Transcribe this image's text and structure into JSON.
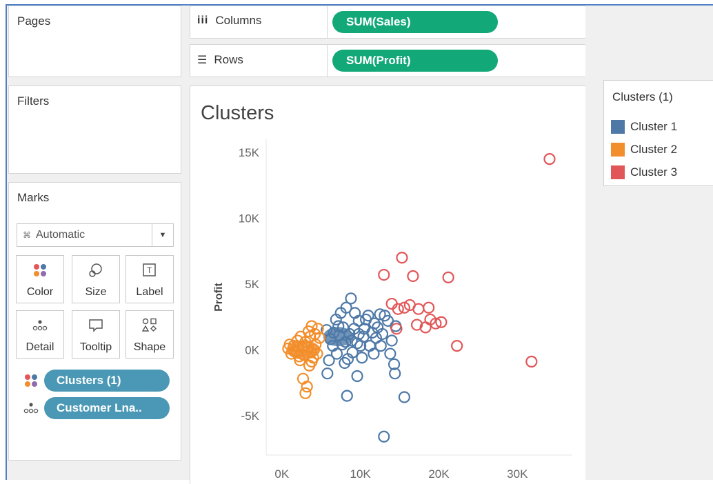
{
  "shelves": {
    "pages_label": "Pages",
    "filters_label": "Filters",
    "columns_label": "Columns",
    "columns_pill": "SUM(Sales)",
    "rows_label": "Rows",
    "rows_pill": "SUM(Profit)"
  },
  "marks": {
    "title": "Marks",
    "mark_type": "Automatic",
    "buttons": [
      "Color",
      "Size",
      "Label",
      "Detail",
      "Tooltip",
      "Shape"
    ],
    "fields": [
      "Clusters (1)",
      "Customer Lna.."
    ]
  },
  "legend": {
    "title": "Clusters (1)",
    "items": [
      {
        "label": "Cluster 1",
        "color": "#4e79a7"
      },
      {
        "label": "Cluster 2",
        "color": "#f28e2b"
      },
      {
        "label": "Cluster 3",
        "color": "#e15759"
      }
    ]
  },
  "chart_title": "Clusters",
  "chart_data": {
    "type": "scatter",
    "title": "Clusters",
    "xlabel": "",
    "ylabel": "Profit",
    "xlim": [
      -2000,
      37000
    ],
    "ylim": [
      -8000,
      16000
    ],
    "xticks": [
      {
        "v": 0,
        "label": "0K"
      },
      {
        "v": 10000,
        "label": "10K"
      },
      {
        "v": 20000,
        "label": "20K"
      },
      {
        "v": 30000,
        "label": "30K"
      }
    ],
    "yticks": [
      {
        "v": 15000,
        "label": "15K"
      },
      {
        "v": 10000,
        "label": "10K"
      },
      {
        "v": 5000,
        "label": "5K"
      },
      {
        "v": 0,
        "label": "0K"
      },
      {
        "v": -5000,
        "label": "-5K"
      }
    ],
    "grid": false,
    "marker": "open-circle",
    "series": [
      {
        "name": "Cluster 1",
        "color": "#4e79a7",
        "points": [
          [
            8800,
            3900
          ],
          [
            8200,
            3200
          ],
          [
            7500,
            2800
          ],
          [
            9800,
            2200
          ],
          [
            11000,
            2600
          ],
          [
            12500,
            2700
          ],
          [
            11800,
            2000
          ],
          [
            10500,
            1600
          ],
          [
            13500,
            2200
          ],
          [
            12800,
            1200
          ],
          [
            14500,
            1800
          ],
          [
            14000,
            700
          ],
          [
            13800,
            -300
          ],
          [
            12000,
            900
          ],
          [
            11200,
            300
          ],
          [
            10200,
            -600
          ],
          [
            9000,
            -200
          ],
          [
            8100,
            600
          ],
          [
            7300,
            1100
          ],
          [
            6500,
            300
          ],
          [
            7000,
            -300
          ],
          [
            6000,
            -800
          ],
          [
            5800,
            -1800
          ],
          [
            8000,
            -1000
          ],
          [
            9600,
            -2000
          ],
          [
            14300,
            -1100
          ],
          [
            14400,
            -1800
          ],
          [
            15600,
            -3600
          ],
          [
            8300,
            -3500
          ],
          [
            13000,
            -6600
          ],
          [
            6900,
            2300
          ],
          [
            7800,
            1700
          ],
          [
            8600,
            1200
          ],
          [
            9300,
            2800
          ],
          [
            10700,
            2300
          ],
          [
            12200,
            1700
          ],
          [
            13100,
            2600
          ],
          [
            11500,
            1300
          ],
          [
            9800,
            1200
          ],
          [
            8900,
            700
          ],
          [
            9600,
            500
          ],
          [
            10400,
            1000
          ],
          [
            6200,
            800
          ],
          [
            5700,
            1500
          ],
          [
            7200,
            1800
          ],
          [
            6600,
            1300
          ],
          [
            7700,
            400
          ],
          [
            8400,
            -700
          ],
          [
            9200,
            1600
          ],
          [
            10000,
            300
          ],
          [
            11700,
            -300
          ],
          [
            12600,
            300
          ]
        ]
      },
      {
        "name": "Cluster 2",
        "color": "#f28e2b",
        "points": [
          [
            3000,
            -3300
          ],
          [
            3200,
            -2800
          ],
          [
            2700,
            -2200
          ],
          [
            3800,
            1800
          ],
          [
            4200,
            1200
          ],
          [
            3500,
            -1200
          ],
          [
            2200,
            -500
          ],
          [
            1500,
            300
          ],
          [
            800,
            100
          ],
          [
            4500,
            -300
          ],
          [
            4800,
            900
          ],
          [
            3000,
            600
          ],
          [
            2400,
            1000
          ],
          [
            1900,
            -200
          ],
          [
            3800,
            -900
          ],
          [
            4300,
            400
          ],
          [
            2800,
            -400
          ],
          [
            1200,
            -300
          ],
          [
            3300,
            200
          ],
          [
            4000,
            -600
          ],
          [
            2000,
            700
          ],
          [
            3600,
            1000
          ],
          [
            1600,
            -100
          ],
          [
            2600,
            200
          ],
          [
            4600,
            1600
          ],
          [
            3400,
            1400
          ],
          [
            4100,
            0
          ],
          [
            2300,
            -800
          ],
          [
            3700,
            -200
          ],
          [
            1000,
            400
          ]
        ]
      },
      {
        "name": "Cluster 3",
        "color": "#e15759",
        "points": [
          [
            34100,
            14500
          ],
          [
            15300,
            7000
          ],
          [
            13000,
            5700
          ],
          [
            16700,
            5600
          ],
          [
            21200,
            5500
          ],
          [
            14000,
            3500
          ],
          [
            15600,
            3200
          ],
          [
            16300,
            3400
          ],
          [
            17400,
            3100
          ],
          [
            18700,
            3200
          ],
          [
            14800,
            3100
          ],
          [
            17200,
            1900
          ],
          [
            18300,
            1700
          ],
          [
            18900,
            2300
          ],
          [
            19600,
            2000
          ],
          [
            20300,
            2100
          ],
          [
            14600,
            1600
          ],
          [
            22300,
            300
          ],
          [
            31800,
            -900
          ]
        ]
      }
    ]
  }
}
